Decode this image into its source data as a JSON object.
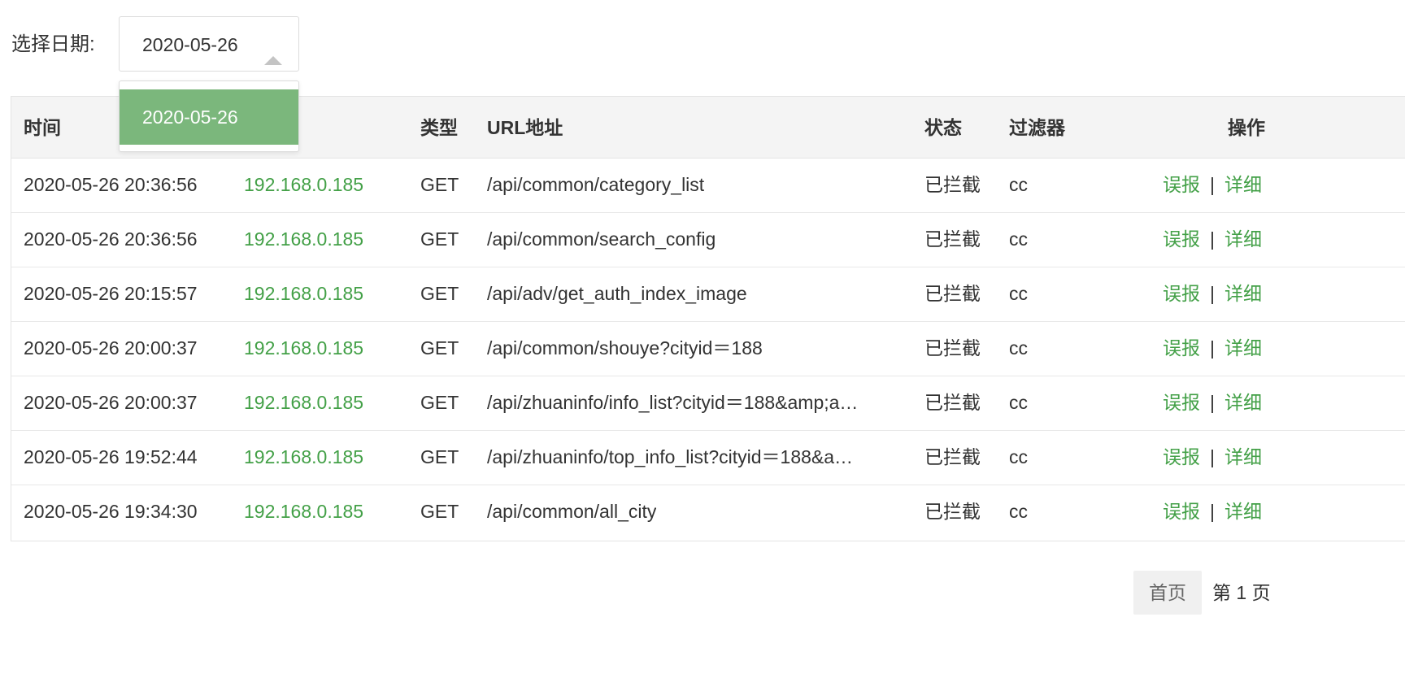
{
  "filter": {
    "label": "选择日期:",
    "selected_date": "2020-05-26",
    "options": [
      "2020-05-26"
    ]
  },
  "table": {
    "headers": {
      "time": "时间",
      "type": "类型",
      "url": "URL地址",
      "status": "状态",
      "filter": "过滤器",
      "action": "操作"
    },
    "rows": [
      {
        "time": "2020-05-26 20:36:56",
        "ip": "192.168.0.185",
        "type": "GET",
        "url": "/api/common/category_list",
        "status": "已拦截",
        "filter": "cc",
        "false_report": "误报",
        "sep": "|",
        "detail": "详细"
      },
      {
        "time": "2020-05-26 20:36:56",
        "ip": "192.168.0.185",
        "type": "GET",
        "url": "/api/common/search_config",
        "status": "已拦截",
        "filter": "cc",
        "false_report": "误报",
        "sep": "|",
        "detail": "详细"
      },
      {
        "time": "2020-05-26 20:15:57",
        "ip": "192.168.0.185",
        "type": "GET",
        "url": "/api/adv/get_auth_index_image",
        "status": "已拦截",
        "filter": "cc",
        "false_report": "误报",
        "sep": "|",
        "detail": "详细"
      },
      {
        "time": "2020-05-26 20:00:37",
        "ip": "192.168.0.185",
        "type": "GET",
        "url": "/api/common/shouye?cityid＝188",
        "status": "已拦截",
        "filter": "cc",
        "false_report": "误报",
        "sep": "|",
        "detail": "详细"
      },
      {
        "time": "2020-05-26 20:00:37",
        "ip": "192.168.0.185",
        "type": "GET",
        "url": "/api/zhuaninfo/info_list?cityid＝188&amp;a…",
        "status": "已拦截",
        "filter": "cc",
        "false_report": "误报",
        "sep": "|",
        "detail": "详细"
      },
      {
        "time": "2020-05-26 19:52:44",
        "ip": "192.168.0.185",
        "type": "GET",
        "url": "/api/zhuaninfo/top_info_list?cityid＝188&a…",
        "status": "已拦截",
        "filter": "cc",
        "false_report": "误报",
        "sep": "|",
        "detail": "详细"
      },
      {
        "time": "2020-05-26 19:34:30",
        "ip": "192.168.0.185",
        "type": "GET",
        "url": "/api/common/all_city",
        "status": "已拦截",
        "filter": "cc",
        "false_report": "误报",
        "sep": "|",
        "detail": "详细"
      }
    ]
  },
  "pagination": {
    "first_label": "首页",
    "current_label": "第 1 页"
  },
  "colors": {
    "accent": "#43a047",
    "selected_option_bg": "#7bb77c",
    "header_bg": "#f4f4f4"
  },
  "icons": {
    "select_caret": "caret-up-icon"
  }
}
